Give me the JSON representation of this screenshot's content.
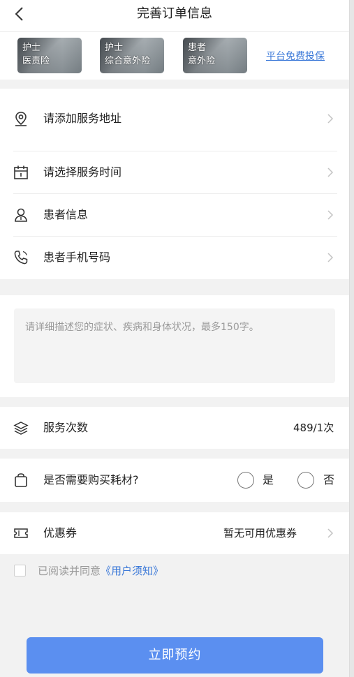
{
  "header": {
    "title": "完善订单信息",
    "back_icon": "chevron-left-icon"
  },
  "insurance": {
    "badges": [
      {
        "line1": "护士",
        "line2": "医责险"
      },
      {
        "line1": "护士",
        "line2": "综合意外险"
      },
      {
        "line1": "患者",
        "line2": "意外险"
      }
    ],
    "link": "平台免费投保"
  },
  "service_rows": [
    {
      "label": "请添加服务地址",
      "icon": "location-pin-icon"
    },
    {
      "label": "请选择服务时间",
      "icon": "calendar-icon"
    },
    {
      "label": "患者信息",
      "icon": "patient-icon"
    },
    {
      "label": "患者手机号码",
      "icon": "phone-icon"
    }
  ],
  "description": {
    "placeholder": "请详细描述您的症状、疾病和身体状况，最多150字。"
  },
  "service_count": {
    "label": "服务次数",
    "value": "489/1次",
    "icon": "layers-icon"
  },
  "materials": {
    "label": "是否需要购买耗材?",
    "yes": "是",
    "no": "否",
    "icon": "bag-icon"
  },
  "coupon": {
    "label": "优惠券",
    "value": "暂无可用优惠券",
    "icon": "ticket-icon"
  },
  "agreement": {
    "prefix": "已阅读并同意",
    "link": "《用户须知》"
  },
  "submit": {
    "label": "立即预约"
  },
  "colors": {
    "accent": "#3a78d8",
    "button": "#5b8ff0",
    "background": "#f2f2f2"
  }
}
